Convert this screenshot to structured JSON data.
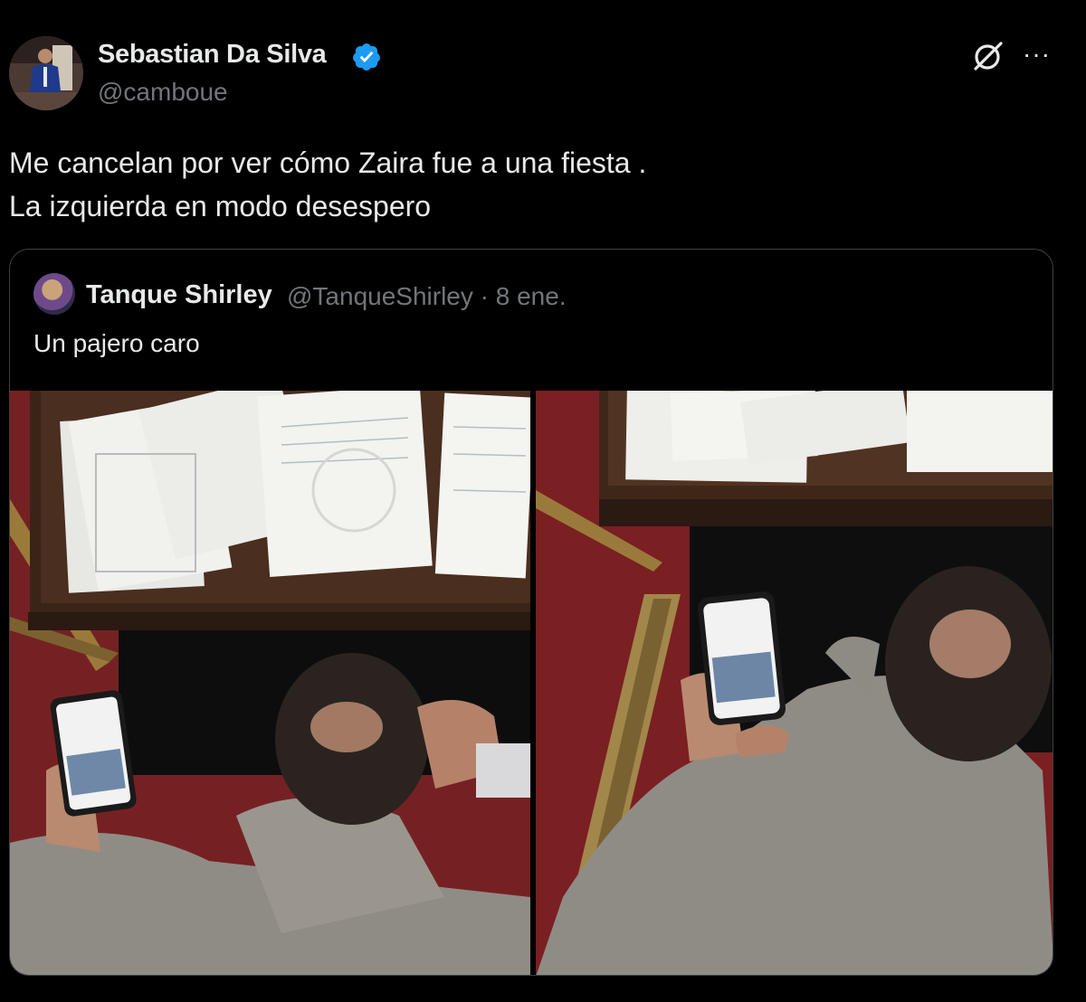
{
  "post": {
    "author_name": "Sebastian Da Silva",
    "author_handle": "@camboue",
    "verified_icon": "verified-badge-icon",
    "text_lines": [
      "Me cancelan por ver cómo Zaira fue a una fiesta .",
      "La izquierda en modo desespero"
    ],
    "more_label": "···"
  },
  "quoted": {
    "author_name": "Tanque Shirley",
    "meta": "@TanqueShirley · 8 ene.",
    "text": "Un pajero caro"
  },
  "colors": {
    "background": "#000000",
    "text": "#e7e9ea",
    "muted": "#71767b",
    "verified": "#1d9bf0",
    "border": "#3e4144"
  }
}
